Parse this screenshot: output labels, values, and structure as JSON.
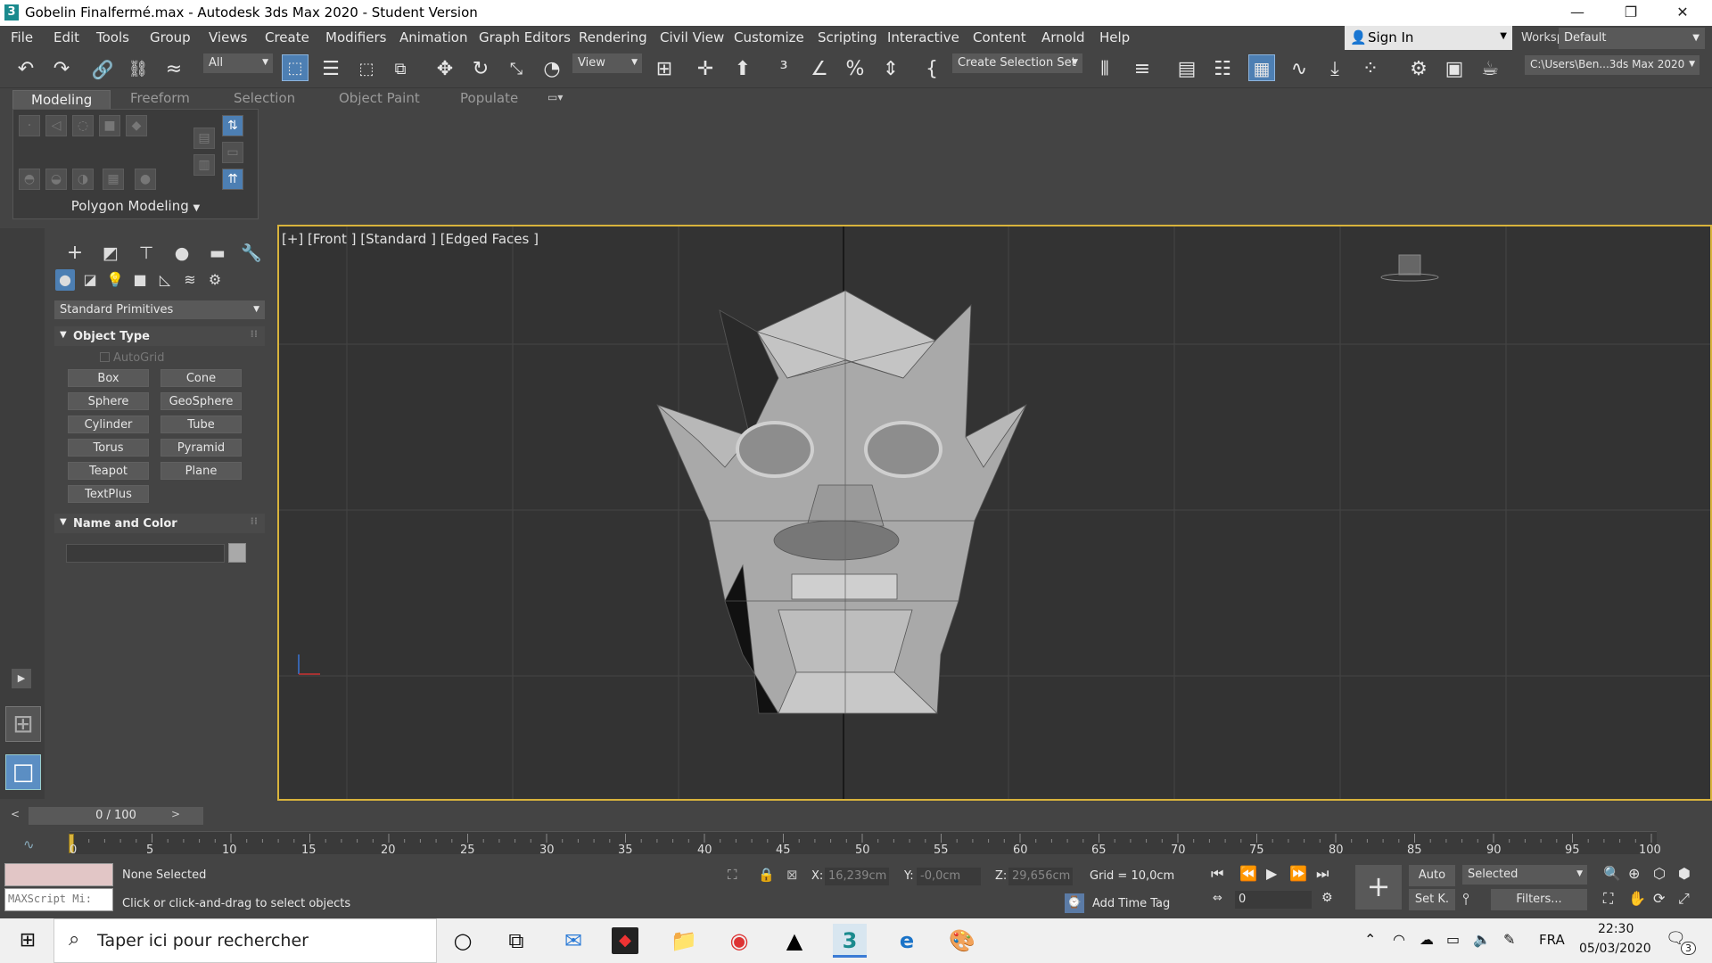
{
  "window": {
    "title": "Gobelin Finalfermé.max - Autodesk 3ds Max 2020 - Student Version",
    "app_icon": "3",
    "minimize": "—",
    "restore": "❐",
    "close": "✕"
  },
  "menubar": {
    "items": [
      "File",
      "Edit",
      "Tools",
      "Group",
      "Views",
      "Create",
      "Modifiers",
      "Animation",
      "Graph Editors",
      "Rendering",
      "Civil View",
      "Customize",
      "Scripting",
      "Interactive",
      "Content",
      "Arnold",
      "Help"
    ],
    "signin": "Sign In",
    "workspaces_label": "Workspaces:",
    "workspace_value": "Default"
  },
  "toolbar": {
    "selection_filter": "All",
    "ref_coord": "View",
    "named_selection": "Create Selection Set",
    "project_path": "C:\\Users\\Ben...3ds Max 2020"
  },
  "ribbon": {
    "tabs": [
      "Modeling",
      "Freeform",
      "Selection",
      "Object Paint",
      "Populate"
    ],
    "active_tab": "Modeling",
    "panel_label": "Polygon Modeling"
  },
  "command_panel": {
    "category": "Standard Primitives",
    "object_type_header": "Object Type",
    "autogrid": "AutoGrid",
    "buttons": [
      "Box",
      "Cone",
      "Sphere",
      "GeoSphere",
      "Cylinder",
      "Tube",
      "Torus",
      "Pyramid",
      "Teapot",
      "Plane",
      "TextPlus"
    ],
    "name_color_header": "Name and Color",
    "color": "#a9a9a9"
  },
  "viewport": {
    "label": "[+] [Front ] [Standard ] [Edged Faces ]",
    "border_color": "#d8b33c"
  },
  "timeline": {
    "slider_value": "0 / 100",
    "ticks": [
      "0",
      "5",
      "10",
      "15",
      "20",
      "25",
      "30",
      "35",
      "40",
      "45",
      "50",
      "55",
      "60",
      "65",
      "70",
      "75",
      "80",
      "85",
      "90",
      "95",
      "100"
    ]
  },
  "status": {
    "maxscript": "MAXScript Mi:",
    "selection_state": "None Selected",
    "prompt": "Click or click-and-drag to select objects",
    "x_label": "X:",
    "x_value": "16,239cm",
    "y_label": "Y:",
    "y_value": "-0,0cm",
    "z_label": "Z:",
    "z_value": "29,656cm",
    "grid": "Grid = 10,0cm",
    "add_time_tag": "Add Time Tag",
    "frame_value": "0",
    "auto": "Auto",
    "selected": "Selected",
    "set_key": "Set K.",
    "filters": "Filters..."
  },
  "taskbar": {
    "search_placeholder": "Taper ici pour rechercher",
    "language": "FRA",
    "time": "22:30",
    "date": "05/03/2020",
    "notifications": "3"
  }
}
